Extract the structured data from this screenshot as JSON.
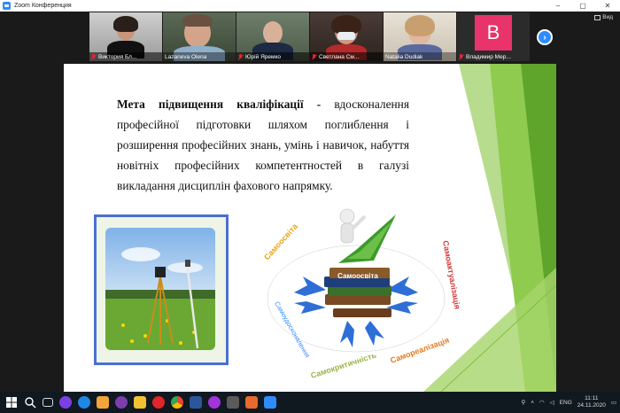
{
  "window": {
    "title": "Zoom Конференция",
    "controls": [
      "–",
      "▢",
      "✕"
    ]
  },
  "participants": [
    {
      "name": "Виктория Бл..."
    },
    {
      "name": "Lazaneva Olena"
    },
    {
      "name": "Юрій Яремко"
    },
    {
      "name": "Светлана См..."
    },
    {
      "name": "Natalia Dudiak"
    },
    {
      "name": "Владимир Мер...",
      "avatar_letter": "B"
    }
  ],
  "view_button": {
    "label": "Вид"
  },
  "slide": {
    "heading": "Мета підвищення кваліфікації -",
    "body": " вдосконалення професійної підготовки шляхом поглиблення і розширення професійних знань, умінь і навичок, набуття новітніх професійних компетентностей в галузі викладання дисциплін фахового напрямку.",
    "diagram": {
      "center": "Самоосвіта",
      "labels": [
        "Самоосвіта",
        "Самоактуалізація",
        "Самоудосконалення",
        "Самокритичність",
        "Самореалізація",
        "Самоосвіта"
      ]
    }
  },
  "taskbar": {
    "language": "ENG",
    "time": "11:11",
    "date": "24.11.2020",
    "icons": [
      "windows-icon",
      "search-icon",
      "task-view-icon",
      "yandex-icon",
      "edge-icon",
      "store-icon",
      "viber-icon",
      "explorer-icon",
      "opera-icon",
      "chrome-icon",
      "word-icon",
      "messenger-icon",
      "calculator-icon",
      "notepad-icon",
      "zoom-icon"
    ]
  },
  "colors": {
    "zoom_blue": "#2d8cff",
    "slide_green": "#7dc13f",
    "frame_blue": "#4b6fd1",
    "avatar_pink": "#e8336b"
  }
}
